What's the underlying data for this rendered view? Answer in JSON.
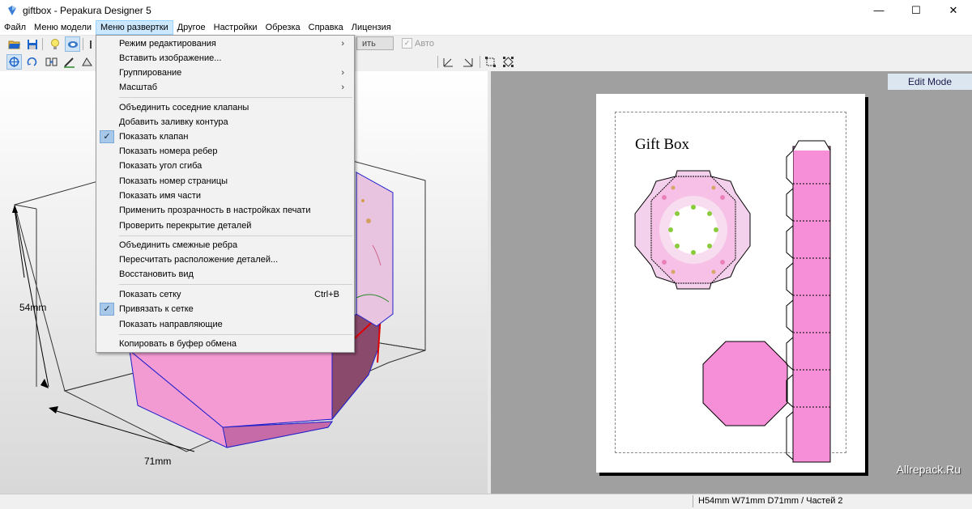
{
  "window": {
    "title": "giftbox - Pepakura Designer 5",
    "minimize": "—",
    "maximize": "☐",
    "close": "✕"
  },
  "menubar": [
    "Файл",
    "Меню модели",
    "Меню развертки",
    "Другое",
    "Настройки",
    "Обрезка",
    "Справка",
    "Лицензия"
  ],
  "toolbar": {
    "partial_button_label": "ить",
    "auto_label": "Авто"
  },
  "dropdown": {
    "items": [
      {
        "label": "Режим редактирования",
        "submenu": true
      },
      {
        "label": "Вставить изображение..."
      },
      {
        "label": "Группирование",
        "submenu": true
      },
      {
        "label": "Масштаб",
        "submenu": true
      },
      {
        "label": "Объединить соседние клапаны"
      },
      {
        "label": "Добавить заливку контура"
      },
      {
        "label": "Показать клапан",
        "checked": true
      },
      {
        "label": "Показать номера ребер"
      },
      {
        "label": "Показать угол сгиба"
      },
      {
        "label": "Показать номер страницы"
      },
      {
        "label": "Показать имя части"
      },
      {
        "label": "Применить прозрачность в настройках печати"
      },
      {
        "label": "Проверить перекрытие деталей"
      },
      {
        "label": "Объединить смежные ребра"
      },
      {
        "label": "Пересчитать расположение деталей..."
      },
      {
        "label": "Восстановить вид"
      },
      {
        "label": "Показать сетку",
        "shortcut": "Ctrl+B"
      },
      {
        "label": "Привязать к сетке",
        "checked": true
      },
      {
        "label": "Показать направляющие"
      },
      {
        "label": "Копировать в буфер обмена"
      }
    ],
    "submenu_glyph": "›",
    "check_glyph": "✓"
  },
  "view3d": {
    "height_label": "54mm",
    "width_label": "71mm",
    "box_color": "#f49bd4",
    "edge_color": "#2020cc"
  },
  "view2d": {
    "mode_label": "Edit Mode",
    "paper_title": "Gift Box",
    "watermark": "Allrepack.Ru",
    "part_color": "#f78fd8"
  },
  "status": {
    "text": "H54mm W71mm D71mm / Частей 2"
  }
}
